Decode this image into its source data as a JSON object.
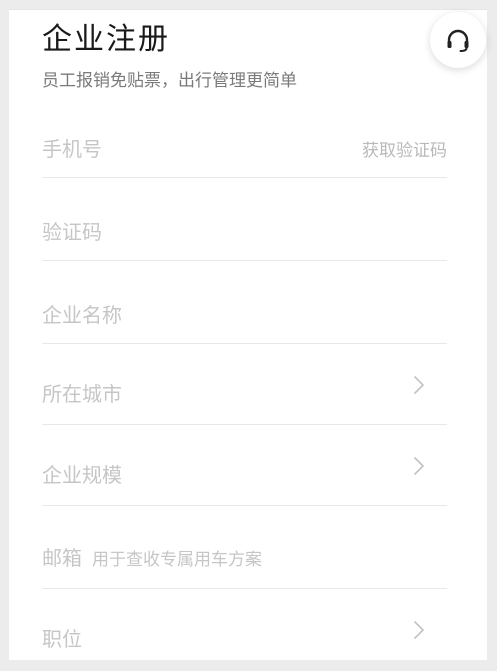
{
  "header": {
    "title": "企业注册",
    "subtitle": "员工报销免贴票，出行管理更简单"
  },
  "support": {
    "icon": "headset-icon"
  },
  "form": {
    "phone": {
      "label": "手机号",
      "action": "获取验证码"
    },
    "code": {
      "label": "验证码"
    },
    "company": {
      "label": "企业名称"
    },
    "city": {
      "label": "所在城市"
    },
    "scale": {
      "label": "企业规模"
    },
    "email": {
      "label": "邮箱",
      "hint": "用于查收专属用车方案"
    },
    "position": {
      "label": "职位"
    }
  },
  "colors": {
    "title": "#1a1a1a",
    "placeholder": "#c6c6c6",
    "divider": "#e8e8e8",
    "background": "#ececec"
  }
}
